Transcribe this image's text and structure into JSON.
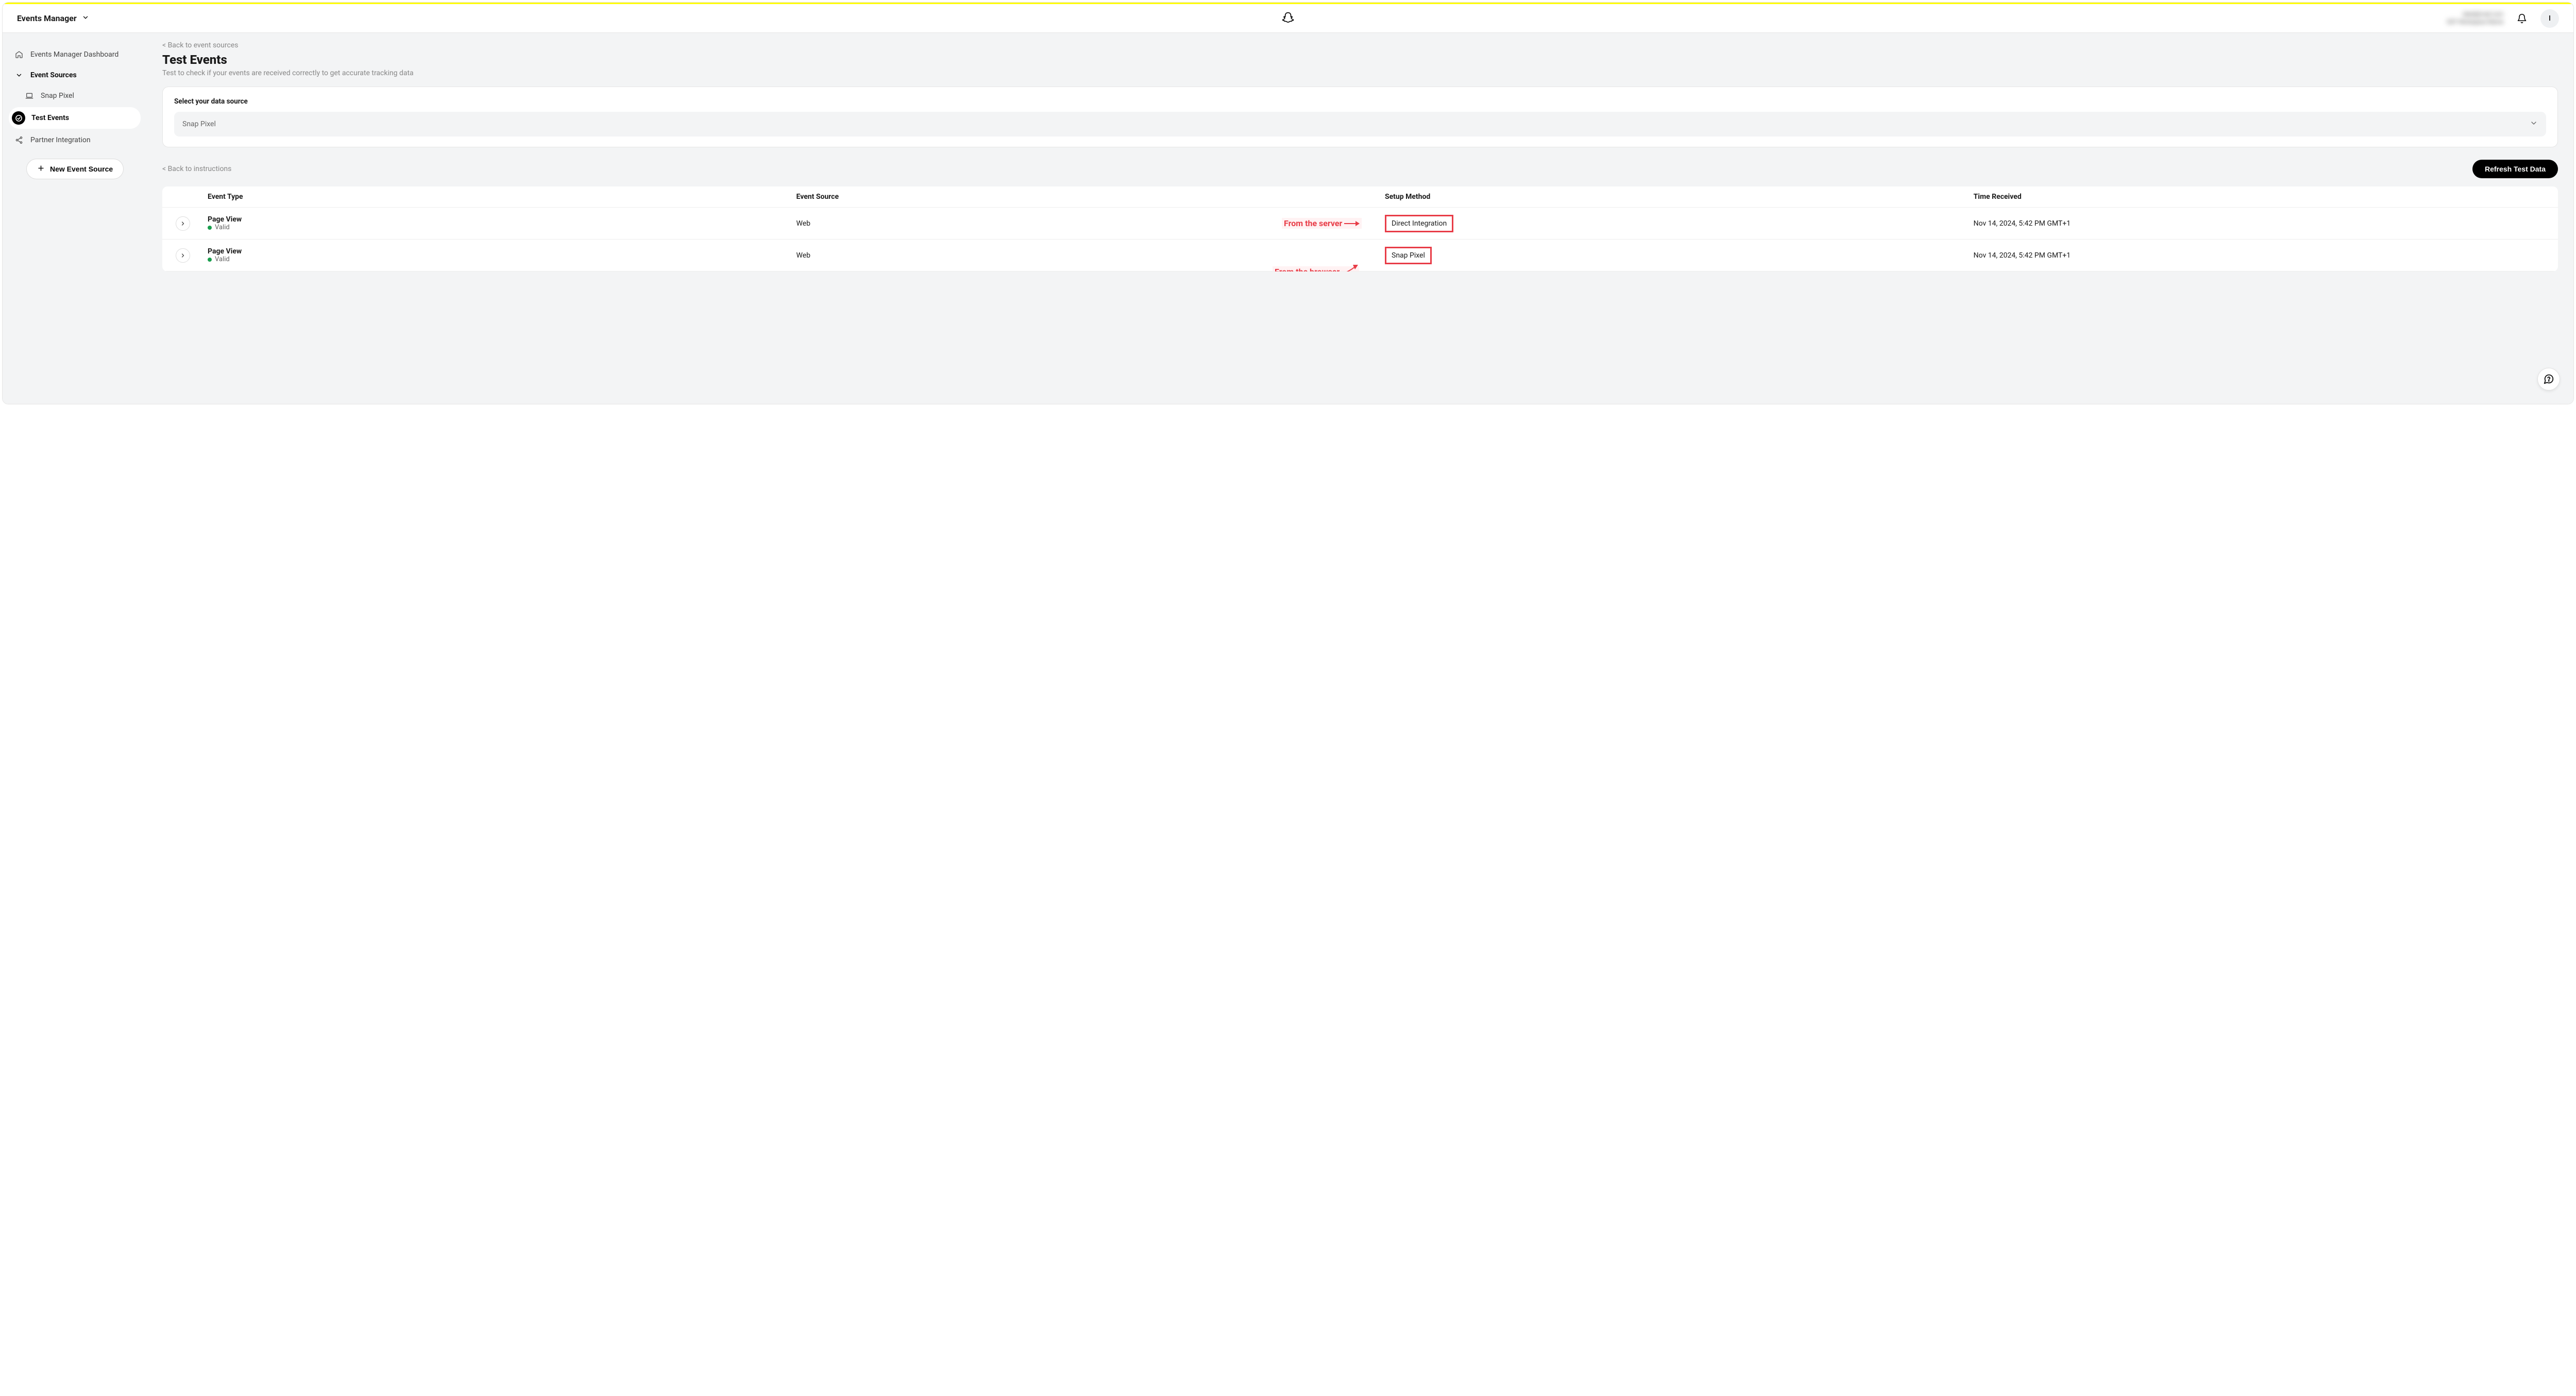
{
  "header": {
    "app_name": "Events Manager",
    "avatar_initial": "I",
    "blurred_line1": "label@mail.com",
    "blurred_line2": "GST Workspace Name"
  },
  "sidebar": {
    "dashboard_label": "Events Manager Dashboard",
    "event_sources_label": "Event Sources",
    "snap_pixel_label": "Snap Pixel",
    "test_events_label": "Test Events",
    "partner_integration_label": "Partner Integration",
    "new_source_label": "New Event Source"
  },
  "main": {
    "back_to_sources": "< Back to event sources",
    "title": "Test Events",
    "subtitle": "Test to check if your events are received correctly to get accurate tracking data",
    "select_label": "Select your data source",
    "select_value": "Snap Pixel",
    "back_to_instructions": "< Back to instructions",
    "refresh_label": "Refresh Test Data"
  },
  "table": {
    "headers": {
      "event_type": "Event Type",
      "event_source": "Event Source",
      "setup_method": "Setup Method",
      "time_received": "Time Received"
    },
    "rows": [
      {
        "event_type": "Page View",
        "status": "Valid",
        "event_source": "Web",
        "setup_method": "Direct Integration",
        "time_received": "Nov 14, 2024, 5:42 PM GMT+1",
        "annotation": "From the server"
      },
      {
        "event_type": "Page View",
        "status": "Valid",
        "event_source": "Web",
        "setup_method": "Snap Pixel",
        "time_received": "Nov 14, 2024, 5:42 PM GMT+1",
        "annotation": "From the browser"
      }
    ]
  }
}
